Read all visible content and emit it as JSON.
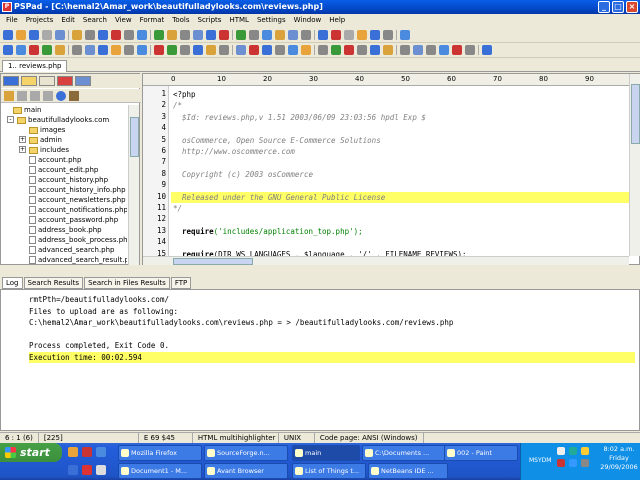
{
  "window": {
    "title": "PSPad - [C:\\hemal2\\Amar_work\\beautifulladylooks.com\\reviews.php]",
    "controls": {
      "minimize": "_",
      "maximize": "□",
      "close": "×"
    }
  },
  "menu": [
    "File",
    "Projects",
    "Edit",
    "Search",
    "View",
    "Format",
    "Tools",
    "Scripts",
    "HTML",
    "Settings",
    "Window",
    "Help"
  ],
  "tab": {
    "label": "1.. reviews.php"
  },
  "tree": {
    "items": [
      {
        "label": "main",
        "type": "root"
      },
      {
        "label": "beautifulladylooks.com",
        "type": "folder"
      },
      {
        "label": "images",
        "type": "folder"
      },
      {
        "label": "admin",
        "type": "folder"
      },
      {
        "label": "includes",
        "type": "folder"
      },
      {
        "label": "account.php",
        "type": "file"
      },
      {
        "label": "account_edit.php",
        "type": "file"
      },
      {
        "label": "account_history.php",
        "type": "file"
      },
      {
        "label": "account_history_info.php",
        "type": "file"
      },
      {
        "label": "account_newsletters.php",
        "type": "file"
      },
      {
        "label": "account_notifications.php",
        "type": "file"
      },
      {
        "label": "account_password.php",
        "type": "file"
      },
      {
        "label": "address_book.php",
        "type": "file"
      },
      {
        "label": "address_book_process.php",
        "type": "file"
      },
      {
        "label": "advanced_search.php",
        "type": "file"
      },
      {
        "label": "advanced_search_result.php",
        "type": "file"
      }
    ]
  },
  "ruler": {
    "marks": [
      "0",
      "10",
      "20",
      "30",
      "40",
      "50",
      "60",
      "70",
      "80",
      "90",
      "100"
    ]
  },
  "editor": {
    "lines": [
      {
        "n": "1",
        "text": "<?php",
        "kind": "code"
      },
      {
        "n": "2",
        "text": "/*",
        "kind": "cmt"
      },
      {
        "n": "3",
        "text": "  $Id: reviews.php,v 1.51 2003/06/09 23:03:56 hpdl Exp $",
        "kind": "cmt"
      },
      {
        "n": "4",
        "text": "",
        "kind": "cmt"
      },
      {
        "n": "5",
        "text": "  osCommerce, Open Source E-Commerce Solutions",
        "kind": "cmt"
      },
      {
        "n": "6",
        "text": "  http://www.oscommerce.com",
        "kind": "cmt"
      },
      {
        "n": "7",
        "text": "",
        "kind": "cmt"
      },
      {
        "n": "8",
        "text": "  Copyright (c) 2003 osCommerce",
        "kind": "cmt"
      },
      {
        "n": "9",
        "text": "",
        "kind": "cmt"
      },
      {
        "n": "10",
        "text": "  Released under the GNU General Public License",
        "kind": "cmt hl"
      },
      {
        "n": "11",
        "text": "*/",
        "kind": "cmt"
      },
      {
        "n": "12",
        "text": "",
        "kind": "code"
      },
      {
        "n": "13",
        "kw": "  require",
        "rest": "('includes/application_top.php');",
        "kind": "req"
      },
      {
        "n": "14",
        "text": "",
        "kind": "code"
      },
      {
        "n": "15",
        "kw": "  require",
        "rest": "(DIR_WS_LANGUAGES . $language . '/' . FILENAME_REVIEWS);",
        "kind": "req2"
      }
    ]
  },
  "log": {
    "tabs": [
      "Log",
      "Search Results",
      "Search in Files Results",
      "FTP"
    ],
    "lines": [
      {
        "text": "rmtPth=/beautifulladylooks.com/",
        "hl": false
      },
      {
        "text": "Files to upload are as following:",
        "hl": false
      },
      {
        "text": "C:\\hemal2\\Amar_work\\beautifulladylooks.com\\reviews.php = > /beautifulladylooks.com/reviews.php",
        "hl": false
      },
      {
        "text": "",
        "hl": false
      },
      {
        "text": "Process completed, Exit Code 0.",
        "hl": false
      },
      {
        "text": "Execution time: 00:02.594",
        "hl": true
      }
    ]
  },
  "status": {
    "pos": "6 : 1 (6)",
    "size": "[225]",
    "encoding": "E  69 $45",
    "highlighter": "HTML multihighlighter",
    "eol": "UNIX",
    "codepage": "Code page: ANSI (Windows)"
  },
  "taskbar": {
    "start": "start",
    "row1": [
      "Mozilla Firefox",
      "SourceForge.n...",
      "main",
      "C:\\Documents ...",
      "002 - Paint"
    ],
    "row2": [
      "Document1 - M...",
      "Avant Browser",
      "List of Things t...",
      "NetBeans IDE ..."
    ],
    "tray_label": "MSYDM",
    "clock": {
      "time": "8:02 a.m.",
      "day": "Friday",
      "date": "29/09/2006"
    }
  },
  "colors": {
    "highlight": "#ffff66",
    "comment": "#808080",
    "string": "#008000",
    "titlebar": "#0a5ee8"
  }
}
